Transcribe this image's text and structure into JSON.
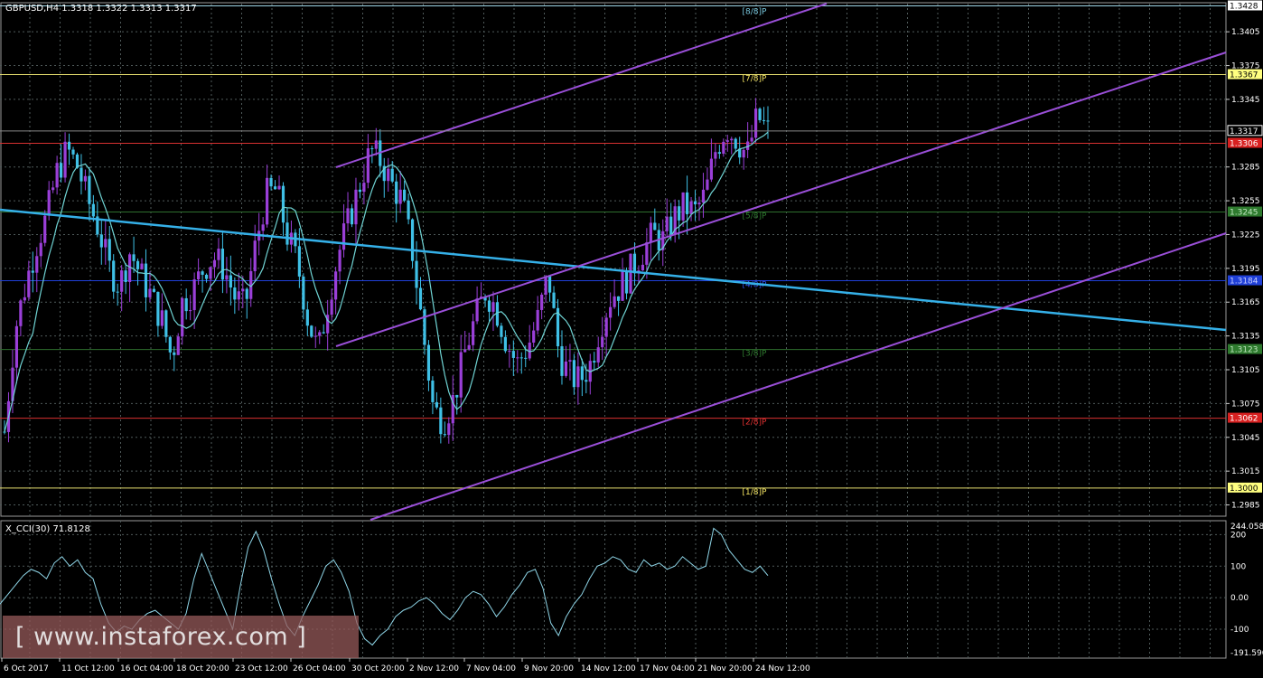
{
  "window": {
    "symbol_header": "GBPUSD,H4  1.3318 1.3322 1.3313 1.3317",
    "cci_header": "X_CCI(30) 71.8128",
    "watermark": "[ www.instaforex.com ]"
  },
  "colors": {
    "background": "#000000",
    "grid": "#4f5a5a",
    "bull_candle": "#9a3fd8",
    "bear_candle": "#3fc0e6",
    "ma_line": "#6fd3d3",
    "trend_line": "#35b0e8",
    "channel": "#9a4fd8",
    "cci_line": "#8fd6e8"
  },
  "chart_data": [
    {
      "type": "candlestick",
      "title": "GBPUSD,H4",
      "ohlc_last": {
        "open": 1.3318,
        "high": 1.3322,
        "low": 1.3313,
        "close": 1.3317
      },
      "x_tick_labels": [
        "6 Oct 2017",
        "11 Oct 12:00",
        "16 Oct 04:00",
        "18 Oct 20:00",
        "23 Oct 12:00",
        "26 Oct 04:00",
        "30 Oct 20:00",
        "2 Nov 12:00",
        "7 Nov 04:00",
        "9 Nov 20:00",
        "14 Nov 12:00",
        "17 Nov 04:00",
        "21 Nov 20:00",
        "24 Nov 12:00"
      ],
      "y_tick_labels": [
        "1.3405",
        "1.3375",
        "1.3345",
        "1.3285",
        "1.3255",
        "1.3225",
        "1.3195",
        "1.3165",
        "1.3135",
        "1.3105",
        "1.3075",
        "1.3045",
        "1.3015",
        "1.2985"
      ],
      "ylim": [
        1.2975,
        1.343
      ],
      "price_path": [
        1.305,
        1.314,
        1.318,
        1.3215,
        1.324,
        1.328,
        1.33,
        1.3285,
        1.3255,
        1.323,
        1.3195,
        1.318,
        1.321,
        1.319,
        1.317,
        1.315,
        1.3115,
        1.3165,
        1.3175,
        1.3195,
        1.3205,
        1.3195,
        1.317,
        1.316,
        1.3215,
        1.326,
        1.3265,
        1.3225,
        1.32,
        1.315,
        1.312,
        1.317,
        1.321,
        1.324,
        1.327,
        1.33,
        1.329,
        1.327,
        1.3255,
        1.321,
        1.314,
        1.307,
        1.306,
        1.308,
        1.312,
        1.315,
        1.3175,
        1.316,
        1.313,
        1.311,
        1.3125,
        1.315,
        1.319,
        1.312,
        1.31,
        1.3095,
        1.311,
        1.3145,
        1.317,
        1.318,
        1.3195,
        1.321,
        1.3225,
        1.322,
        1.324,
        1.325,
        1.3245,
        1.326,
        1.33,
        1.332,
        1.331,
        1.3295,
        1.333,
        1.3317
      ],
      "levels": [
        {
          "label": "[8/8]P",
          "price": "1.3428",
          "value": 1.3428,
          "color": "#9fd6e8",
          "price_box": "#ffffff",
          "price_text": "#000000",
          "label_color": "#79c9e0"
        },
        {
          "label": "[7/8]P",
          "price": "1.3367",
          "value": 1.3367,
          "color": "#e8e070",
          "price_box": "#ffff80",
          "price_text": "#000000",
          "label_color": "#f0e060"
        },
        {
          "label": "",
          "price": "1.3306",
          "value": 1.3306,
          "color": "#d83030",
          "price_box": "#d82020",
          "price_text": "#ffffff",
          "label_color": "#e03030"
        },
        {
          "label": "[5/8]P",
          "price": "1.3245",
          "value": 1.3245,
          "color": "#2e6f2e",
          "price_box": "#2e7a2e",
          "price_text": "#bfe6bf",
          "label_color": "#2e7a2e"
        },
        {
          "label": "[4/8]P",
          "price": "1.3184",
          "value": 1.3184,
          "color": "#2040d8",
          "price_box": "#2040d8",
          "price_text": "#c8d0ff",
          "label_color": "#2f4fe8"
        },
        {
          "label": "[3/8]P",
          "price": "1.3123",
          "value": 1.3123,
          "color": "#2e6f2e",
          "price_box": "#2e7a2e",
          "price_text": "#bfe6bf",
          "label_color": "#2e7a2e"
        },
        {
          "label": "[2/8]P",
          "price": "1.3062",
          "value": 1.3062,
          "color": "#d83030",
          "price_box": "#d82020",
          "price_text": "#ffffff",
          "label_color": "#e03030"
        },
        {
          "label": "[1/8]P",
          "price": "1.3000",
          "value": 1.3,
          "color": "#e8e070",
          "price_box": "#ffff80",
          "price_text": "#000000",
          "label_color": "#f0e060"
        }
      ],
      "current_price": "1.3317",
      "grid": true
    },
    {
      "type": "line",
      "title": "X_CCI(30) 71.8128",
      "y_tick_labels": [
        "244.0586",
        "200",
        "100",
        "0.00",
        "-100",
        "-191.596"
      ],
      "ylim": [
        -191.596,
        244.0586
      ],
      "values": [
        -20,
        10,
        40,
        70,
        90,
        80,
        60,
        110,
        130,
        100,
        120,
        80,
        60,
        -20,
        -80,
        -110,
        -90,
        -100,
        -70,
        -50,
        -40,
        -60,
        -80,
        -100,
        -50,
        60,
        140,
        80,
        20,
        -40,
        -100,
        40,
        160,
        210,
        150,
        60,
        -20,
        -90,
        -120,
        -60,
        -10,
        40,
        100,
        120,
        80,
        20,
        -80,
        -130,
        -150,
        -120,
        -100,
        -60,
        -40,
        -30,
        -10,
        0,
        -20,
        -50,
        -70,
        -40,
        0,
        20,
        10,
        -20,
        -60,
        -30,
        10,
        40,
        80,
        90,
        30,
        -80,
        -120,
        -60,
        -20,
        10,
        60,
        100,
        110,
        130,
        120,
        90,
        80,
        120,
        100,
        110,
        90,
        100,
        130,
        110,
        90,
        100,
        220,
        200,
        150,
        120,
        90,
        80,
        100,
        70
      ]
    }
  ]
}
